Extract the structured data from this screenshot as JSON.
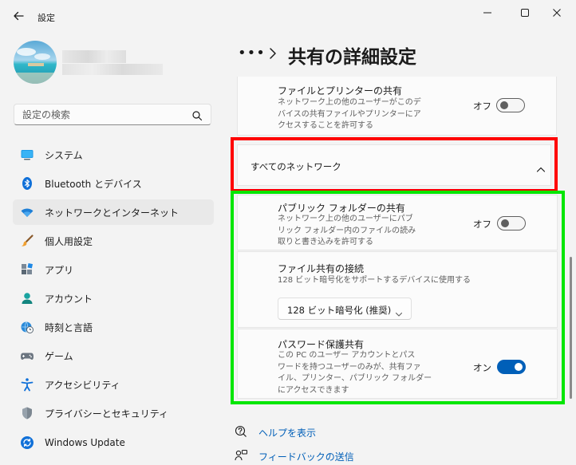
{
  "window": {
    "title": "設定",
    "controls": [
      "minimize-icon",
      "maximize-icon",
      "close-icon"
    ]
  },
  "search": {
    "placeholder": "設定の検索"
  },
  "nav": {
    "items": [
      {
        "label": "システム",
        "icon": "monitor-icon",
        "selected": false
      },
      {
        "label": "Bluetooth とデバイス",
        "icon": "bluetooth-icon",
        "selected": false
      },
      {
        "label": "ネットワークとインターネット",
        "icon": "wifi-icon",
        "selected": true
      },
      {
        "label": "個人用設定",
        "icon": "brush-icon",
        "selected": false
      },
      {
        "label": "アプリ",
        "icon": "apps-icon",
        "selected": false
      },
      {
        "label": "アカウント",
        "icon": "person-icon",
        "selected": false
      },
      {
        "label": "時刻と言語",
        "icon": "clock-globe-icon",
        "selected": false
      },
      {
        "label": "ゲーム",
        "icon": "gamepad-icon",
        "selected": false
      },
      {
        "label": "アクセシビリティ",
        "icon": "accessibility-icon",
        "selected": false
      },
      {
        "label": "プライバシーとセキュリティ",
        "icon": "shield-icon",
        "selected": false
      },
      {
        "label": "Windows Update",
        "icon": "update-icon",
        "selected": false
      }
    ]
  },
  "breadcrumb": {
    "dots": "•••",
    "title": "共有の詳細設定"
  },
  "sections": {
    "file_printer": {
      "title": "ファイルとプリンターの共有",
      "desc": [
        "ネットワーク上の他のユーザーがこのデ",
        "バイスの共有ファイルやプリンターにア",
        "クセスすることを許可する"
      ],
      "state_label": "オフ",
      "on": false
    },
    "all_networks": {
      "title": "すべてのネットワーク",
      "expanded": true
    },
    "public_folder": {
      "title": "パブリック フォルダーの共有",
      "desc": [
        "ネットワーク上の他のユーザーにパブ",
        "リック フォルダー内のファイルの読み",
        "取りと書き込みを許可する"
      ],
      "state_label": "オフ",
      "on": false
    },
    "file_sharing_conn": {
      "title": "ファイル共有の接続",
      "desc": "128 ビット暗号化をサポートするデバイスに使用する",
      "selected": "128 ビット暗号化 (推奨)"
    },
    "password_sharing": {
      "title": "パスワード保護共有",
      "desc": [
        "この PC のユーザー アカウントとパス",
        "ワードを持つユーザーのみが、共有ファ",
        "イル、プリンター、パブリック フォルダー",
        "にアクセスできます"
      ],
      "state_label": "オン",
      "on": true
    }
  },
  "footer": {
    "help": "ヘルプを表示",
    "feedback": "フィードバックの送信"
  },
  "colors": {
    "accent": "#005fb8",
    "highlight_red": "#ff0000",
    "highlight_green": "#00e600"
  }
}
